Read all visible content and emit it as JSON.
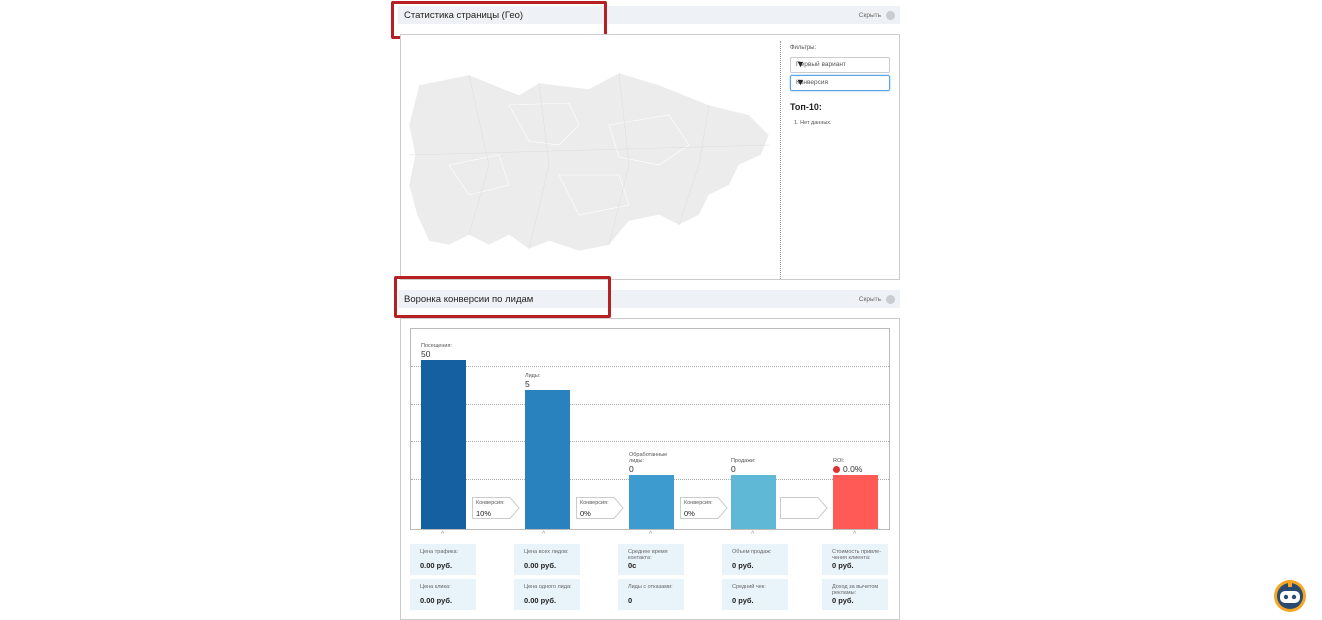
{
  "geo_section": {
    "title": "Статистика страницы (Гео)",
    "hide_label": "Скрыть",
    "filters_label": "Фильтры:",
    "filter_variant": "Первый вариант",
    "filter_metric": "Конверсия",
    "top10_title": "Топ-10:",
    "top10_items": [
      "1. Нет данных."
    ]
  },
  "funnel_section": {
    "title": "Воронка конверсии по лидам",
    "hide_label": "Скрыть"
  },
  "chart_data": {
    "type": "bar",
    "categories": [
      "Посещения:",
      "Лиды:",
      "Обработанные лиды:",
      "Продажи:",
      "ROI:"
    ],
    "values": [
      50,
      5,
      0,
      0,
      0.0
    ],
    "value_labels": [
      "50",
      "5",
      "0",
      "0",
      "0.0%"
    ],
    "colors": [
      "#1560a0",
      "#2981bd",
      "#3d9bd0",
      "#5fb8d6",
      "#ff5a55"
    ],
    "conversions": [
      {
        "label": "Конверсия:",
        "value": "10%"
      },
      {
        "label": "Конверсия:",
        "value": "0%"
      },
      {
        "label": "Конверсия:",
        "value": "0%"
      },
      {
        "label": "",
        "value": ""
      }
    ]
  },
  "stats": [
    [
      {
        "label": "Цена трафика:",
        "value": "0.00 руб."
      },
      {
        "label": "Цена клика:",
        "value": "0.00 руб."
      }
    ],
    [
      {
        "label": "Цена всех лидов:",
        "value": "0.00 руб."
      },
      {
        "label": "Цена одного лида:",
        "value": "0.00 руб."
      }
    ],
    [
      {
        "label": "Среднее время контакта:",
        "value": "0с"
      },
      {
        "label": "Лиды с отказами:",
        "value": "0"
      }
    ],
    [
      {
        "label": "Объем продаж:",
        "value": "0 руб."
      },
      {
        "label": "Средний чек:",
        "value": "0 руб."
      }
    ],
    [
      {
        "label": "Стоимость привле-чения клиента:",
        "value": "0 руб."
      },
      {
        "label": "Доход за вычетом рекламы:",
        "value": "0 руб."
      }
    ]
  ],
  "colors": {
    "accent_red": "#b62025",
    "header_bg": "#eef1f5",
    "stat_bg": "#e9f3fa"
  }
}
